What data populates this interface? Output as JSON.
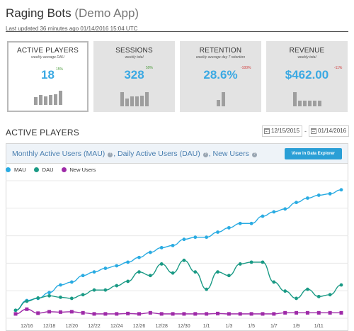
{
  "header": {
    "app_name": "Raging Bots",
    "app_suffix": "(Demo App)",
    "last_updated": "Last updated 36 minutes ago 01/14/2016 15:04 UTC"
  },
  "cards": [
    {
      "title": "ACTIVE PLAYERS",
      "subtitle": "weekly average DAU",
      "value": "18",
      "delta": "15%",
      "trend": "up",
      "bars": [
        0.55,
        0.7,
        0.6,
        0.68,
        0.75,
        1.0
      ],
      "active": true
    },
    {
      "title": "SESSIONS",
      "subtitle": "weekly total",
      "value": "328",
      "delta": "59%",
      "trend": "up",
      "bars": [
        1.0,
        0.55,
        0.7,
        0.7,
        0.75,
        1.0
      ],
      "active": false
    },
    {
      "title": "RETENTION",
      "subtitle": "weekly average day 7 retention",
      "value": "28.6%",
      "delta": "-100%",
      "trend": "down",
      "bars": [
        0.45,
        1.0
      ],
      "active": false
    },
    {
      "title": "REVENUE",
      "subtitle": "weekly total",
      "value": "$462.00",
      "delta": "-11%",
      "trend": "down",
      "bars": [
        1.0,
        0.4,
        0.4,
        0.4,
        0.4,
        0.4
      ],
      "active": false
    }
  ],
  "section": {
    "title": "ACTIVE PLAYERS",
    "date_start": "12/15/2015",
    "date_end": "01/14/2016",
    "separator": "-"
  },
  "panel": {
    "title_parts": [
      "Monthly Active Users (MAU)",
      "Daily Active Users (DAU)",
      "New Users"
    ],
    "button_label": "View in Data Explorer"
  },
  "colors": {
    "mau": "#29abe2",
    "dau": "#1a9a85",
    "new_users": "#9e2aa8",
    "button": "#2a9fd6"
  },
  "chart_data": {
    "type": "line",
    "xlabel": "",
    "ylabel": "",
    "x": [
      "12/15",
      "12/16",
      "12/17",
      "12/18",
      "12/19",
      "12/20",
      "12/21",
      "12/22",
      "12/23",
      "12/24",
      "12/25",
      "12/26",
      "12/27",
      "12/28",
      "12/29",
      "12/30",
      "12/31",
      "1/1",
      "1/2",
      "1/3",
      "1/4",
      "1/5",
      "1/6",
      "1/7",
      "1/8",
      "1/9",
      "1/10",
      "1/11",
      "1/12",
      "1/13"
    ],
    "xticks": [
      "12/16",
      "12/18",
      "12/20",
      "12/22",
      "12/24",
      "12/26",
      "12/28",
      "12/30",
      "1/1",
      "1/3",
      "1/5",
      "1/7",
      "1/9",
      "1/11"
    ],
    "series": [
      {
        "name": "MAU",
        "color_key": "mau",
        "values": [
          22,
          49,
          55,
          71,
          92,
          100,
          118,
          128,
          138,
          145,
          155,
          168,
          182,
          195,
          201,
          218,
          224,
          224,
          238,
          250,
          262,
          262,
          282,
          294,
          302,
          320,
          332,
          340,
          344,
          355
        ]
      },
      {
        "name": "DAU",
        "color_key": "dau",
        "values": [
          22,
          47,
          56,
          62,
          58,
          55,
          65,
          78,
          78,
          90,
          102,
          128,
          118,
          150,
          125,
          160,
          128,
          80,
          128,
          118,
          150,
          155,
          155,
          100,
          75,
          55,
          80,
          60,
          65,
          92
        ]
      },
      {
        "name": "New Users",
        "color_key": "new_users",
        "values": [
          12,
          25,
          14,
          18,
          17,
          18,
          15,
          12,
          12,
          12,
          13,
          12,
          15,
          12,
          12,
          12,
          12,
          12,
          13,
          12,
          12,
          12,
          12,
          12,
          15,
          15,
          15,
          15,
          15,
          15
        ]
      }
    ],
    "ylim": [
      0,
      380
    ],
    "grid": true
  }
}
